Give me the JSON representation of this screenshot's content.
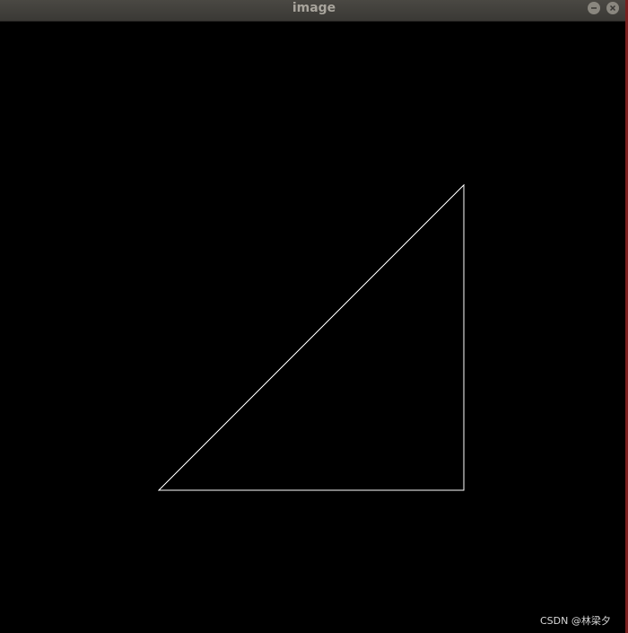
{
  "window": {
    "title": "image",
    "minimize_icon": "minimize-icon",
    "close_icon": "close-icon"
  },
  "canvas": {
    "background": "#000000",
    "shape": "right-triangle",
    "stroke_color": "#ffffff"
  },
  "watermark": {
    "text": "CSDN @林梁夕"
  },
  "colors": {
    "titlebar": "#3d3b37",
    "title_text": "#a9a59d",
    "window_edge": "#7a1f1f"
  }
}
